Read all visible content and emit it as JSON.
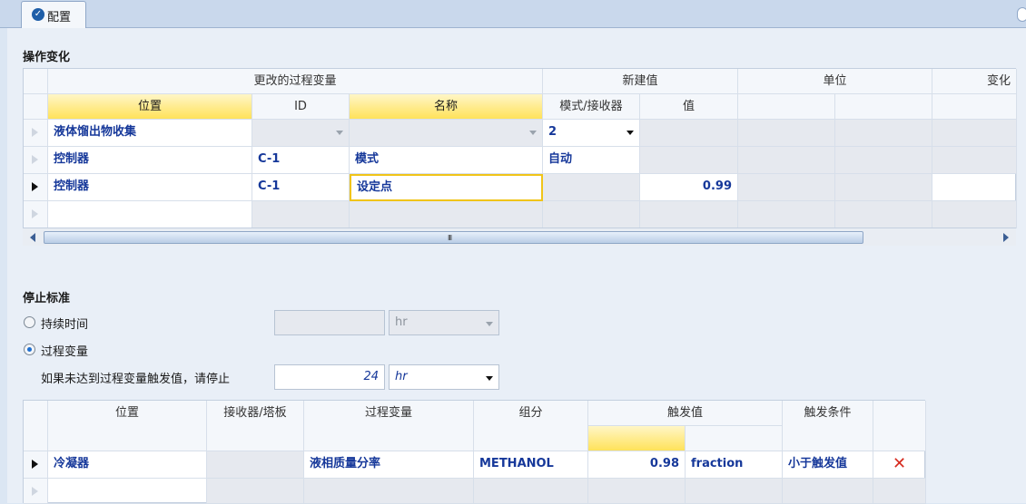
{
  "tab": {
    "label": "配置",
    "icon": "check-circle-icon"
  },
  "manipulation": {
    "title": "操作变化",
    "group_headers": {
      "changed_var": "更改的过程变量",
      "new_value": "新建值",
      "unit": "单位",
      "change": "变化"
    },
    "columns": {
      "location": "位置",
      "id": "ID",
      "name": "名称",
      "mode_receiver": "模式/接收器",
      "value": "值"
    },
    "rows": [
      {
        "location": "液体馏出物收集",
        "id": "",
        "name": "",
        "mode": "2",
        "value": ""
      },
      {
        "location": "控制器",
        "id": "C-1",
        "name": "模式",
        "mode": "自动",
        "value": ""
      },
      {
        "location": "控制器",
        "id": "C-1",
        "name": "设定点",
        "mode": "",
        "value": "0.99"
      }
    ],
    "scroll_grip": "III"
  },
  "stop": {
    "title": "停止标准",
    "duration": {
      "label": "持续时间",
      "value": "",
      "unit": "hr",
      "selected": false
    },
    "process_var": {
      "label": "过程变量",
      "selected": true
    },
    "fallback": {
      "label": "如果未达到过程变量触发值，请停止",
      "value": "24",
      "unit": "hr"
    },
    "columns": {
      "location": "位置",
      "receiver_tray": "接收器/塔板",
      "process_var": "过程变量",
      "component": "组分",
      "trigger": "触发值",
      "condition": "触发条件"
    },
    "rows": [
      {
        "location": "冷凝器",
        "receiver_tray": "",
        "process_var": "液相质量分率",
        "component": "METHANOL",
        "trigger_value": "0.98",
        "trigger_unit": "fraction",
        "condition": "小于触发值",
        "delete": "✕"
      }
    ]
  },
  "colors": {
    "accent_yellow": "#ffe25a",
    "text_blue": "#16389a",
    "delete_red": "#d62b1f"
  }
}
